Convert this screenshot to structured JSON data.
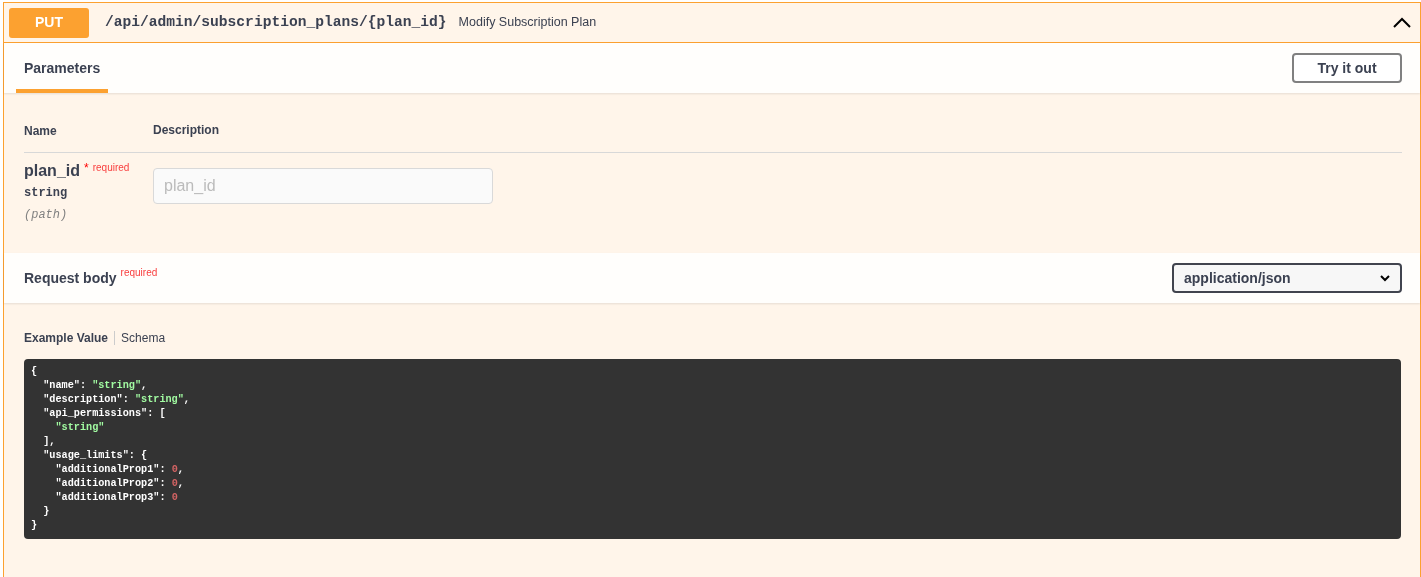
{
  "operation": {
    "method": "PUT",
    "path": "/api/admin/subscription_plans/{plan_id}",
    "summary": "Modify Subscription Plan",
    "expanded": true
  },
  "parameters_section": {
    "tab": "Parameters",
    "button": "Try it out",
    "columns": [
      "Name",
      "Description"
    ],
    "rows": [
      {
        "name": "plan_id",
        "required_mark": "*",
        "required_label": "required",
        "type": "string",
        "location": "(path)",
        "placeholder": "plan_id"
      }
    ]
  },
  "request_body": {
    "title": "Request body",
    "required_label": "required",
    "content_type": "application/json",
    "tabs": [
      {
        "label": "Example Value",
        "selected": true
      },
      {
        "label": "Schema",
        "selected": false
      }
    ],
    "code_lines": [
      [
        {
          "kind": "punct",
          "text": "{"
        }
      ],
      [
        {
          "kind": "punct",
          "text": "  \"name\": "
        },
        {
          "kind": "string",
          "text": "\"string\""
        },
        {
          "kind": "punct",
          "text": ","
        }
      ],
      [
        {
          "kind": "punct",
          "text": "  \"description\": "
        },
        {
          "kind": "string",
          "text": "\"string\""
        },
        {
          "kind": "punct",
          "text": ","
        }
      ],
      [
        {
          "kind": "punct",
          "text": "  \"api_permissions\": ["
        }
      ],
      [
        {
          "kind": "string",
          "text": "    \"string\""
        }
      ],
      [
        {
          "kind": "punct",
          "text": "  ],"
        }
      ],
      [
        {
          "kind": "punct",
          "text": "  \"usage_limits\": {"
        }
      ],
      [
        {
          "kind": "punct",
          "text": "    \"additionalProp1\": "
        },
        {
          "kind": "number",
          "text": "0"
        },
        {
          "kind": "punct",
          "text": ","
        }
      ],
      [
        {
          "kind": "punct",
          "text": "    \"additionalProp2\": "
        },
        {
          "kind": "number",
          "text": "0"
        },
        {
          "kind": "punct",
          "text": ","
        }
      ],
      [
        {
          "kind": "punct",
          "text": "    \"additionalProp3\": "
        },
        {
          "kind": "number",
          "text": "0"
        }
      ],
      [
        {
          "kind": "punct",
          "text": "  }"
        }
      ],
      [
        {
          "kind": "punct",
          "text": "}"
        }
      ]
    ]
  }
}
